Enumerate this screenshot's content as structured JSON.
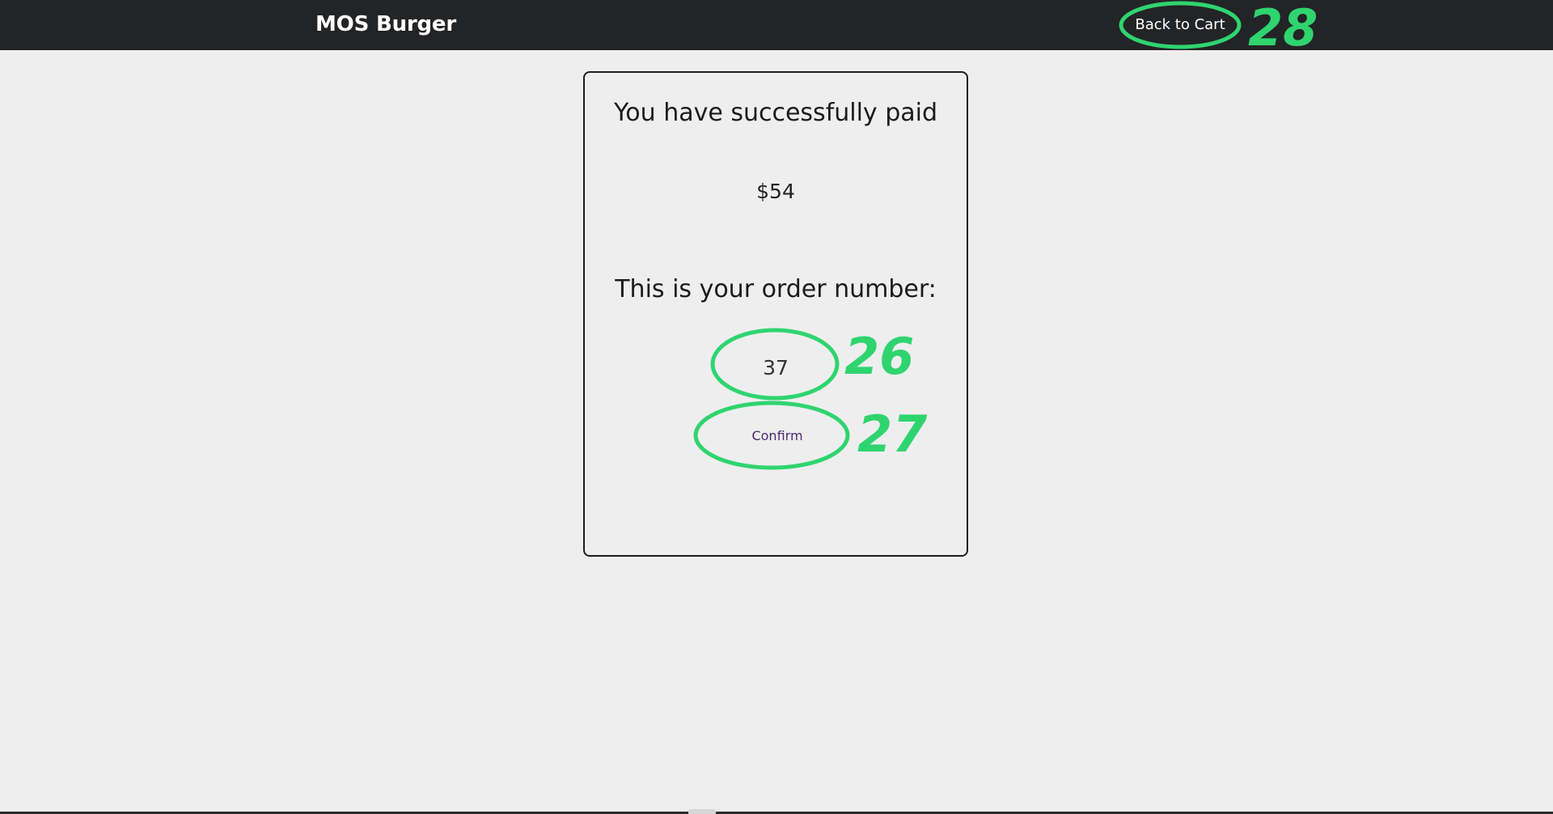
{
  "header": {
    "brand": "MOS Burger",
    "back_to_cart_label": "Back to Cart"
  },
  "payment": {
    "success_message": "You have successfully paid",
    "amount": "$54",
    "order_number_label": "This is your order number:",
    "order_number": "37",
    "confirm_label": "Confirm"
  },
  "annotations": {
    "color": "#2fd46f",
    "labels": [
      "26",
      "27",
      "28"
    ]
  },
  "colors": {
    "header_background": "#232426",
    "page_background": "#eeeeee",
    "confirm_text": "#4b2a6e"
  }
}
